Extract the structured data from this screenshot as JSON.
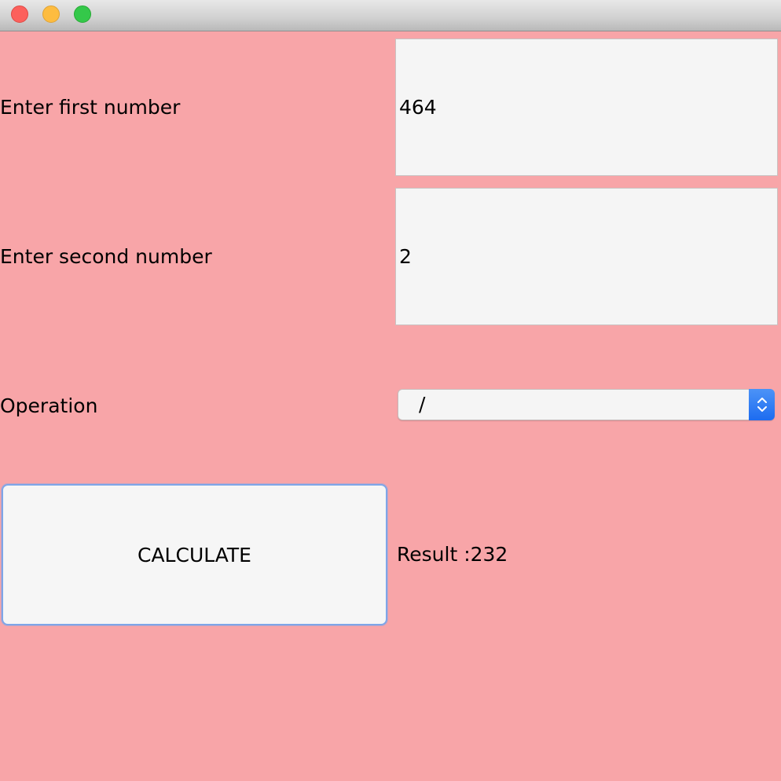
{
  "window": {
    "controls": [
      "close-icon",
      "minimize-icon",
      "maximize-icon"
    ],
    "background_color": "#f8a5a8"
  },
  "form": {
    "first_number": {
      "label": "Enter first number",
      "value": "464"
    },
    "second_number": {
      "label": "Enter second number",
      "value": "2"
    },
    "operation": {
      "label": "Operation",
      "selected": "/"
    }
  },
  "actions": {
    "calculate_label": "CALCULATE"
  },
  "result": {
    "text": "Result :232"
  },
  "colors": {
    "select_accent": "#1d6cf0",
    "button_focus": "#7ea6e8"
  }
}
